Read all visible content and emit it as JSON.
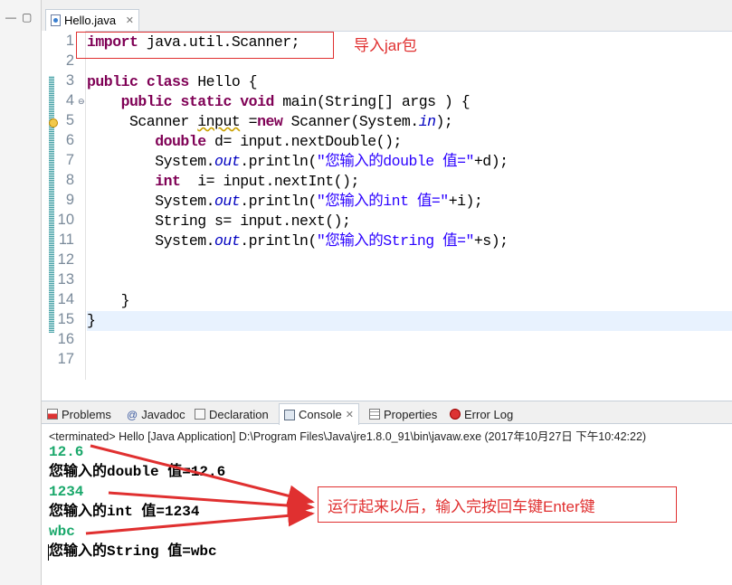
{
  "left_strip": {
    "minimize_label": "—",
    "maximize_label": "▢"
  },
  "editor": {
    "tab": {
      "title": "Hello.java",
      "close": "✕"
    },
    "line_numbers": [
      "1",
      "2",
      "3",
      "4",
      "5",
      "6",
      "7",
      "8",
      "9",
      "10",
      "11",
      "12",
      "13",
      "14",
      "15",
      "16",
      "17"
    ],
    "code": {
      "l1": [
        "import",
        " java.util.Scanner;"
      ],
      "l3": [
        "public",
        " ",
        "class",
        " Hello {"
      ],
      "l4": [
        "    ",
        "public",
        " ",
        "static",
        " ",
        "void",
        " main(String[] args ) {"
      ],
      "l5": [
        "     Scanner ",
        "input",
        " =",
        "new",
        " Scanner(System.",
        "in",
        ");"
      ],
      "l6": [
        "        ",
        "double",
        " d= input.nextDouble();"
      ],
      "l7": [
        "        System.",
        "out",
        ".println(",
        "\"您输入的double 值=\"",
        "+d);"
      ],
      "l8": [
        "        ",
        "int",
        "  i= input.nextInt();"
      ],
      "l9": [
        "        System.",
        "out",
        ".println(",
        "\"您输入的int 值=\"",
        "+i);"
      ],
      "l10": [
        "        String s= input.next();"
      ],
      "l11": [
        "        System.",
        "out",
        ".println(",
        "\"您输入的String 值=\"",
        "+s);"
      ],
      "l14": [
        "    }"
      ],
      "l15": [
        "}"
      ]
    },
    "annotation_import": "导入jar包"
  },
  "panel": {
    "tabs": [
      {
        "label": "Problems"
      },
      {
        "label": "Javadoc"
      },
      {
        "label": "Declaration"
      },
      {
        "label": "Console",
        "close": "✕"
      },
      {
        "label": "Properties"
      },
      {
        "label": "Error Log"
      }
    ],
    "console_header": "<terminated> Hello [Java Application] D:\\Program Files\\Java\\jre1.8.0_91\\bin\\javaw.exe (2017年10月27日 下午10:42:22)",
    "console_lines": [
      {
        "text": "12.6",
        "kind": "input"
      },
      {
        "text": "您输入的double 值=12.6",
        "kind": "output"
      },
      {
        "text": "1234",
        "kind": "input"
      },
      {
        "text": "您输入的int 值=1234",
        "kind": "output"
      },
      {
        "text": "wbc",
        "kind": "input"
      },
      {
        "text": "您输入的String 值=wbc",
        "kind": "output"
      }
    ],
    "annotation_run": "运行起来以后，输入完按回车键Enter键"
  },
  "colors": {
    "keyword": "#7f0055",
    "string": "#2a00ff",
    "field": "#0000c0",
    "console_input": "#1aa86b",
    "annotation": "#e03030"
  }
}
